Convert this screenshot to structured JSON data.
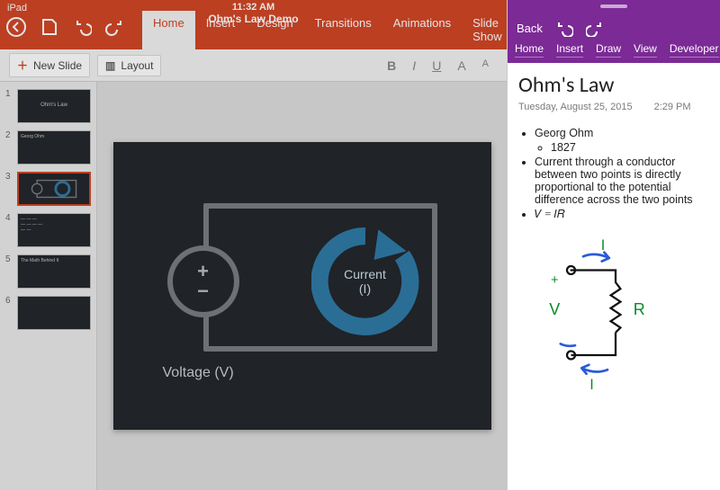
{
  "ppt": {
    "status_device": "iPad",
    "time": "11:32 AM",
    "doc_title": "Ohm's Law Demo",
    "tabs": [
      "Home",
      "Insert",
      "Design",
      "Transitions",
      "Animations",
      "Slide Show"
    ],
    "toolbar": {
      "new_slide": "New Slide",
      "layout": "Layout"
    },
    "fmt_labels": {
      "b": "B",
      "i": "I",
      "u": "U",
      "a1": "A",
      "a2": "A"
    },
    "thumb_count": 6,
    "selected_slide": 3,
    "thumb_titles": [
      "Ohm's Law",
      "Georg Ohm",
      "",
      "",
      "The Math Behind It",
      ""
    ],
    "slide": {
      "voltage_label": "Voltage (V)",
      "current_label": "Current (I)",
      "plus": "+",
      "minus": "−"
    }
  },
  "onenote": {
    "back": "Back",
    "tabs": [
      "Home",
      "Insert",
      "Draw",
      "View",
      "Developer"
    ],
    "title": "Ohm's Law",
    "date": "Tuesday, August 25, 2015",
    "time": "2:29 PM",
    "bullets": {
      "b1": "Georg Ohm",
      "b1a": "1827",
      "b2": "Current through a conductor between two points is directly proportional to the potential difference across the two points",
      "b3": "𝑉 = 𝐼𝑅"
    },
    "sketch_labels": {
      "I_top": "I",
      "I_bot": "I",
      "V": "V",
      "R": "R",
      "plus": "+",
      "minus": "-"
    }
  }
}
